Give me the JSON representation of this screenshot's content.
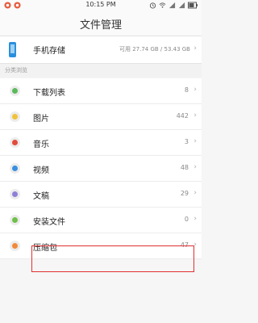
{
  "statusbar": {
    "time": "10:15 PM"
  },
  "header": {
    "title": "文件管理"
  },
  "storage": {
    "label": "手机存储",
    "capacity": "可用 27.74 GB / 53.43 GB",
    "chevron": "›"
  },
  "section": {
    "label": "分类浏览"
  },
  "categories": [
    {
      "name": "下载列表",
      "count": "8",
      "chevron": "›",
      "color": "#5cb85c"
    },
    {
      "name": "图片",
      "count": "442",
      "chevron": "›",
      "color": "#f0c23a"
    },
    {
      "name": "音乐",
      "count": "3",
      "chevron": "›",
      "color": "#e24b3b"
    },
    {
      "name": "视频",
      "count": "48",
      "chevron": "›",
      "color": "#3b8fe0"
    },
    {
      "name": "文稿",
      "count": "29",
      "chevron": "›",
      "color": "#8e7fd6"
    },
    {
      "name": "安装文件",
      "count": "0",
      "chevron": "›",
      "color": "#6fbf4a"
    },
    {
      "name": "压缩包",
      "count": "47",
      "chevron": "›",
      "color": "#f08a3a"
    }
  ],
  "highlight_color": "#e03030"
}
